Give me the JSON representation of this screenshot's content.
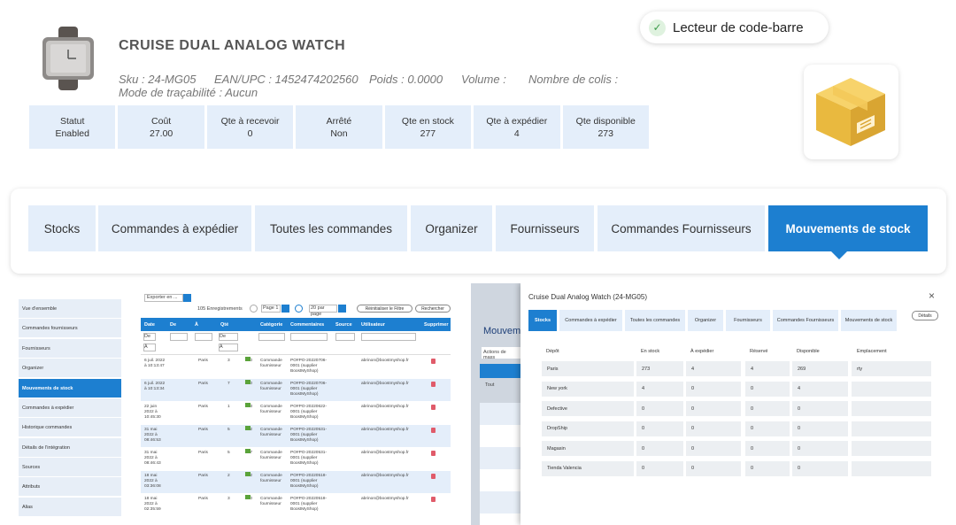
{
  "product": {
    "title": "CRUISE DUAL ANALOG WATCH",
    "sku": "Sku : 24-MG05",
    "ean": "EAN/UPC : 1452474202560",
    "weight": "Poids : 0.0000",
    "volume": "Volume :",
    "parcels": "Nombre de colis :",
    "traceability": "Mode de traçabilité : Aucun"
  },
  "stats": [
    {
      "label": "Statut",
      "value": "Enabled"
    },
    {
      "label": "Coût",
      "value": "27.00"
    },
    {
      "label": "Qte à recevoir",
      "value": "0"
    },
    {
      "label": "Arrêté",
      "value": "Non"
    },
    {
      "label": "Qte en stock",
      "value": "277"
    },
    {
      "label": "Qte à expédier",
      "value": "4"
    },
    {
      "label": "Qte disponible",
      "value": "273"
    }
  ],
  "barcode_label": "Lecteur de code-barre",
  "tabs": [
    "Stocks",
    "Commandes à expédier",
    "Toutes les commandes",
    "Organizer",
    "Fournisseurs",
    "Commandes Fournisseurs",
    "Mouvements de stock"
  ],
  "active_tab": "Mouvements de stock",
  "left_screen": {
    "sidebar": [
      "Vue d'ensemble",
      "Commandes fournisseurs",
      "Fournisseurs",
      "Organizer",
      "Mouvements de stock",
      "Commandes à expédier",
      "Historique commandes",
      "Détails de l'intégration",
      "Sources",
      "Attributs",
      "Alias"
    ],
    "export_label": "Exporter en ...",
    "records": "105 Enregistrements",
    "page_label": "Page 1",
    "per_page": "20 par page",
    "reset_filter": "Réinitialiser le Filtre",
    "search": "Rechercher",
    "columns": [
      "Date",
      "De",
      "À",
      "Qté",
      "Catégorie",
      "Commentaires",
      "Source",
      "Utilisateur",
      "Supprimer"
    ],
    "filter_from": "De",
    "filter_to": "À",
    "rows": [
      {
        "date": "6 juil. 2022 à 10:13:47",
        "to": "Paris",
        "qty": "3",
        "stock": "270",
        "cat": "Commande fournisseur",
        "comment": "PO#PO-20220706-0001 (supplier BoostMyShop)",
        "user": "abrinon@boostmyshop.fr"
      },
      {
        "date": "6 juil. 2022 à 10:13:34",
        "to": "Paris",
        "qty": "7",
        "stock": "270",
        "cat": "Commande fournisseur",
        "comment": "PO#PO-20220706-0001 (supplier BoostMyShop)",
        "user": "abrinon@boostmyshop.fr"
      },
      {
        "date": "22 juin 2022 à 10:45:30",
        "to": "Paris",
        "qty": "1",
        "stock": "263",
        "cat": "Commande fournisseur",
        "comment": "PO#PO-20220622-0001 (supplier BoostMyShop)",
        "user": "abrinon@boostmyshop.fr"
      },
      {
        "date": "31 mai 2022 à 08:46:53",
        "to": "Paris",
        "qty": "5",
        "stock": "262",
        "cat": "Commande fournisseur",
        "comment": "PO#PO-20220531-0001 (supplier BoostMyShop)",
        "user": "abrinon@boostmyshop.fr"
      },
      {
        "date": "31 mai 2022 à 08:46:43",
        "to": "Paris",
        "qty": "5",
        "stock": "257",
        "cat": "Commande fournisseur",
        "comment": "PO#PO-20220531-0001 (supplier BoostMyShop)",
        "user": "abrinon@boostmyshop.fr"
      },
      {
        "date": "18 mai 2022 à 03:36:08",
        "to": "Paris",
        "qty": "2",
        "stock": "252",
        "cat": "Commande fournisseur",
        "comment": "PO#PO-20220518-0001 (supplier BoostMyShop)",
        "user": "abrinon@boostmyshop.fr"
      },
      {
        "date": "18 mai 2022 à 02:35:59",
        "to": "Paris",
        "qty": "3",
        "stock": "250",
        "cat": "Commande fournisseur",
        "comment": "PO#PO-20220518-0001 (supplier BoostMyShop)",
        "user": "abrinon@boostmyshop.fr"
      }
    ]
  },
  "right_screen": {
    "bg_title": "Mouvemen",
    "bg_action": "Actions de mass",
    "bg_all": "Tout",
    "modal_title": "Cruise Dual Analog Watch (24-MG05)",
    "tabs": [
      "Stocks",
      "Commandes à expédier",
      "Toutes les commandes",
      "Organizer",
      "Fournisseurs",
      "Commandes Fournisseurs",
      "Mouvements de stock"
    ],
    "details": "Détails",
    "columns": [
      "Dépôt",
      "En stock",
      "À expédier",
      "Réservé",
      "Disponible",
      "Emplacement"
    ],
    "rows": [
      [
        "Paris",
        "273",
        "4",
        "4",
        "269",
        "rty"
      ],
      [
        "New york",
        "4",
        "0",
        "0",
        "4",
        ""
      ],
      [
        "Defective",
        "0",
        "0",
        "0",
        "0",
        ""
      ],
      [
        "DropShip",
        "0",
        "0",
        "0",
        "0",
        ""
      ],
      [
        "Magasin",
        "0",
        "0",
        "0",
        "0",
        ""
      ],
      [
        "Tienda Valencia",
        "0",
        "0",
        "0",
        "0",
        ""
      ]
    ]
  }
}
